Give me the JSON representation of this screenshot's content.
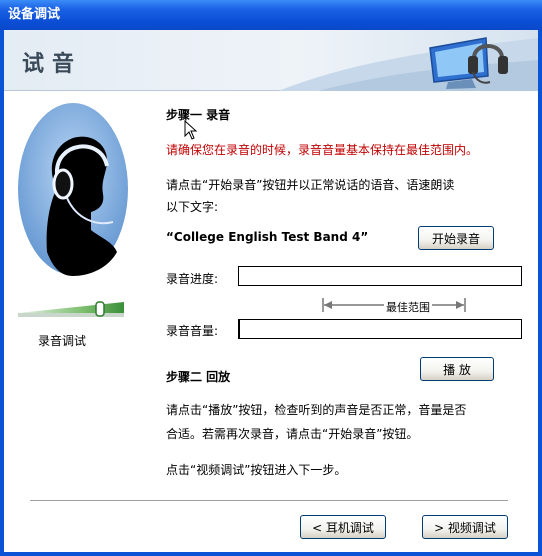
{
  "window": {
    "title": "设备调试"
  },
  "banner": {
    "title": "试音"
  },
  "left": {
    "level_caption": "录音调试"
  },
  "step1": {
    "title": "步骤一  录音",
    "warning": "请确保您在录音的时候，录音音量基本保持在最佳范围内。",
    "instruction_line1": "请点击“开始录音”按钮并以正常说话的语音、语速朗读",
    "instruction_line2": "以下文字:",
    "sample_text": "“College English Test Band 4”",
    "start_button": "开始录音",
    "progress_label": "录音进度:",
    "best_range_label": "最佳范围",
    "volume_label": "录音音量:"
  },
  "step2": {
    "title": "步骤二  回放",
    "play_button": "播 放",
    "instruction_line1": "请点击“播放”按钮，检查听到的声音是否正常，音量是否",
    "instruction_line2": "合适。若需再次录音，请点击“开始录音”按钮。",
    "next_hint": "点击“视频调试”按钮进入下一步。"
  },
  "nav": {
    "back_button": "< 耳机调试",
    "next_button": "> 视频调试"
  },
  "state": {
    "recording_progress": 0,
    "recording_volume": 0,
    "mic_level": 0.75
  }
}
